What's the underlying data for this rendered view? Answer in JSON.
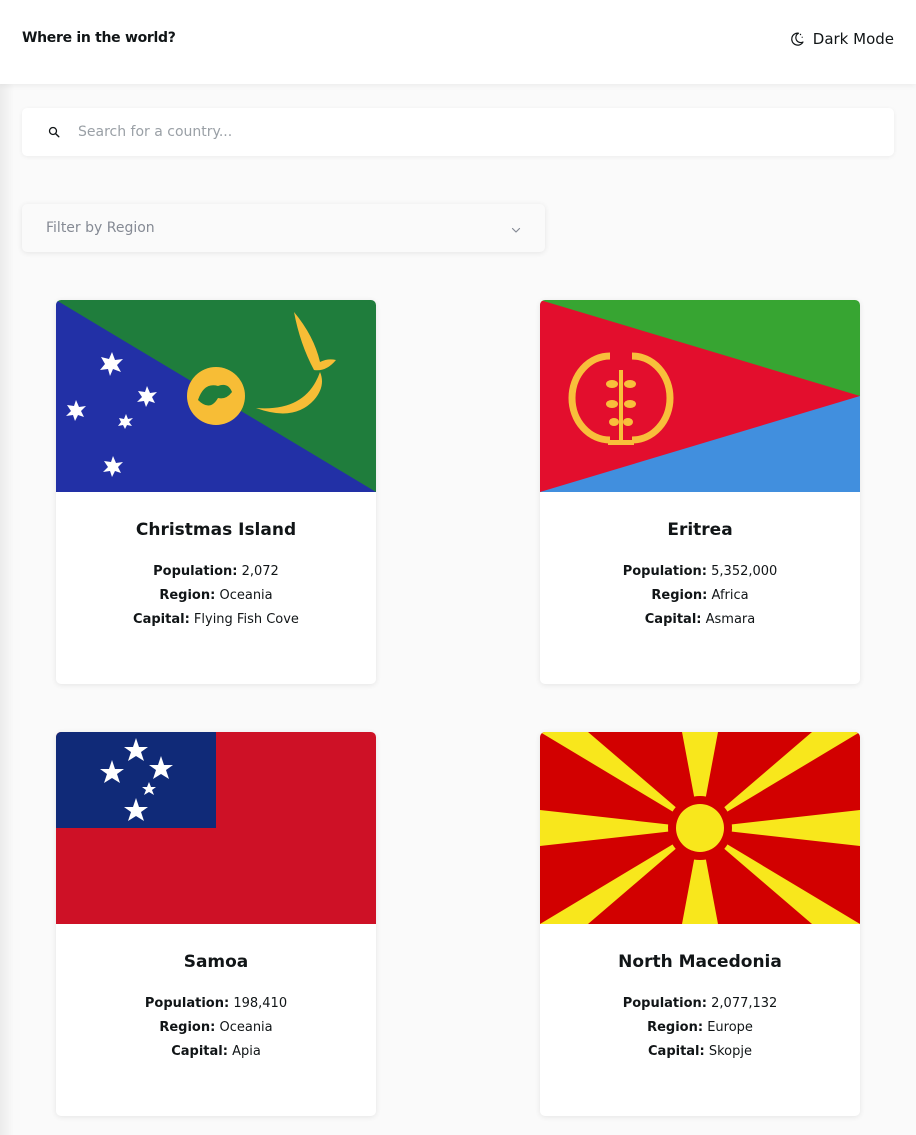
{
  "header": {
    "title": "Where in the world?",
    "mode_label": "Dark Mode",
    "mode_icon": "moon-icon"
  },
  "search": {
    "placeholder": "Search for a country...",
    "value": "",
    "icon": "search-icon"
  },
  "filter": {
    "label": "Filter by Region",
    "icon": "chevron-down-icon"
  },
  "labels": {
    "population": "Population:",
    "region": "Region:",
    "capital": "Capital:"
  },
  "countries": [
    {
      "name": "Christmas Island",
      "population": "2,072",
      "region": "Oceania",
      "capital": "Flying Fish Cove",
      "flag": "christmas-island-flag"
    },
    {
      "name": "Eritrea",
      "population": "5,352,000",
      "region": "Africa",
      "capital": "Asmara",
      "flag": "eritrea-flag"
    },
    {
      "name": "Samoa",
      "population": "198,410",
      "region": "Oceania",
      "capital": "Apia",
      "flag": "samoa-flag"
    },
    {
      "name": "North Macedonia",
      "population": "2,077,132",
      "region": "Europe",
      "capital": "Skopje",
      "flag": "north-macedonia-flag"
    }
  ],
  "colors": {
    "background": "#fafafa",
    "card": "#ffffff",
    "text": "#111517",
    "placeholder": "#9aa0a6"
  }
}
